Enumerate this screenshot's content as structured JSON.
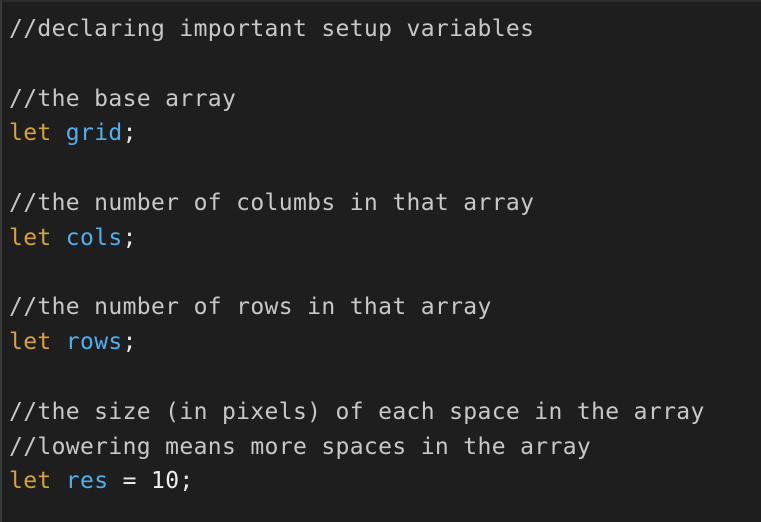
{
  "editor": {
    "lines": [
      {
        "type": "comment",
        "text": "//declaring important setup variables"
      },
      {
        "type": "blank"
      },
      {
        "type": "comment",
        "text": "//the base array"
      },
      {
        "type": "decl",
        "keyword": "let",
        "name": "grid",
        "end": ";"
      },
      {
        "type": "blank"
      },
      {
        "type": "comment",
        "text": "//the number of columbs in that array"
      },
      {
        "type": "decl",
        "keyword": "let",
        "name": "cols",
        "end": ";"
      },
      {
        "type": "blank"
      },
      {
        "type": "comment",
        "text": "//the number of rows in that array"
      },
      {
        "type": "decl",
        "keyword": "let",
        "name": "rows",
        "end": ";"
      },
      {
        "type": "blank"
      },
      {
        "type": "comment",
        "text": "//the size (in pixels) of each space in the array"
      },
      {
        "type": "comment",
        "text": "//lowering means more spaces in the array"
      },
      {
        "type": "assign",
        "keyword": "let",
        "name": "res",
        "op": "=",
        "value": "10",
        "end": ";"
      }
    ]
  }
}
